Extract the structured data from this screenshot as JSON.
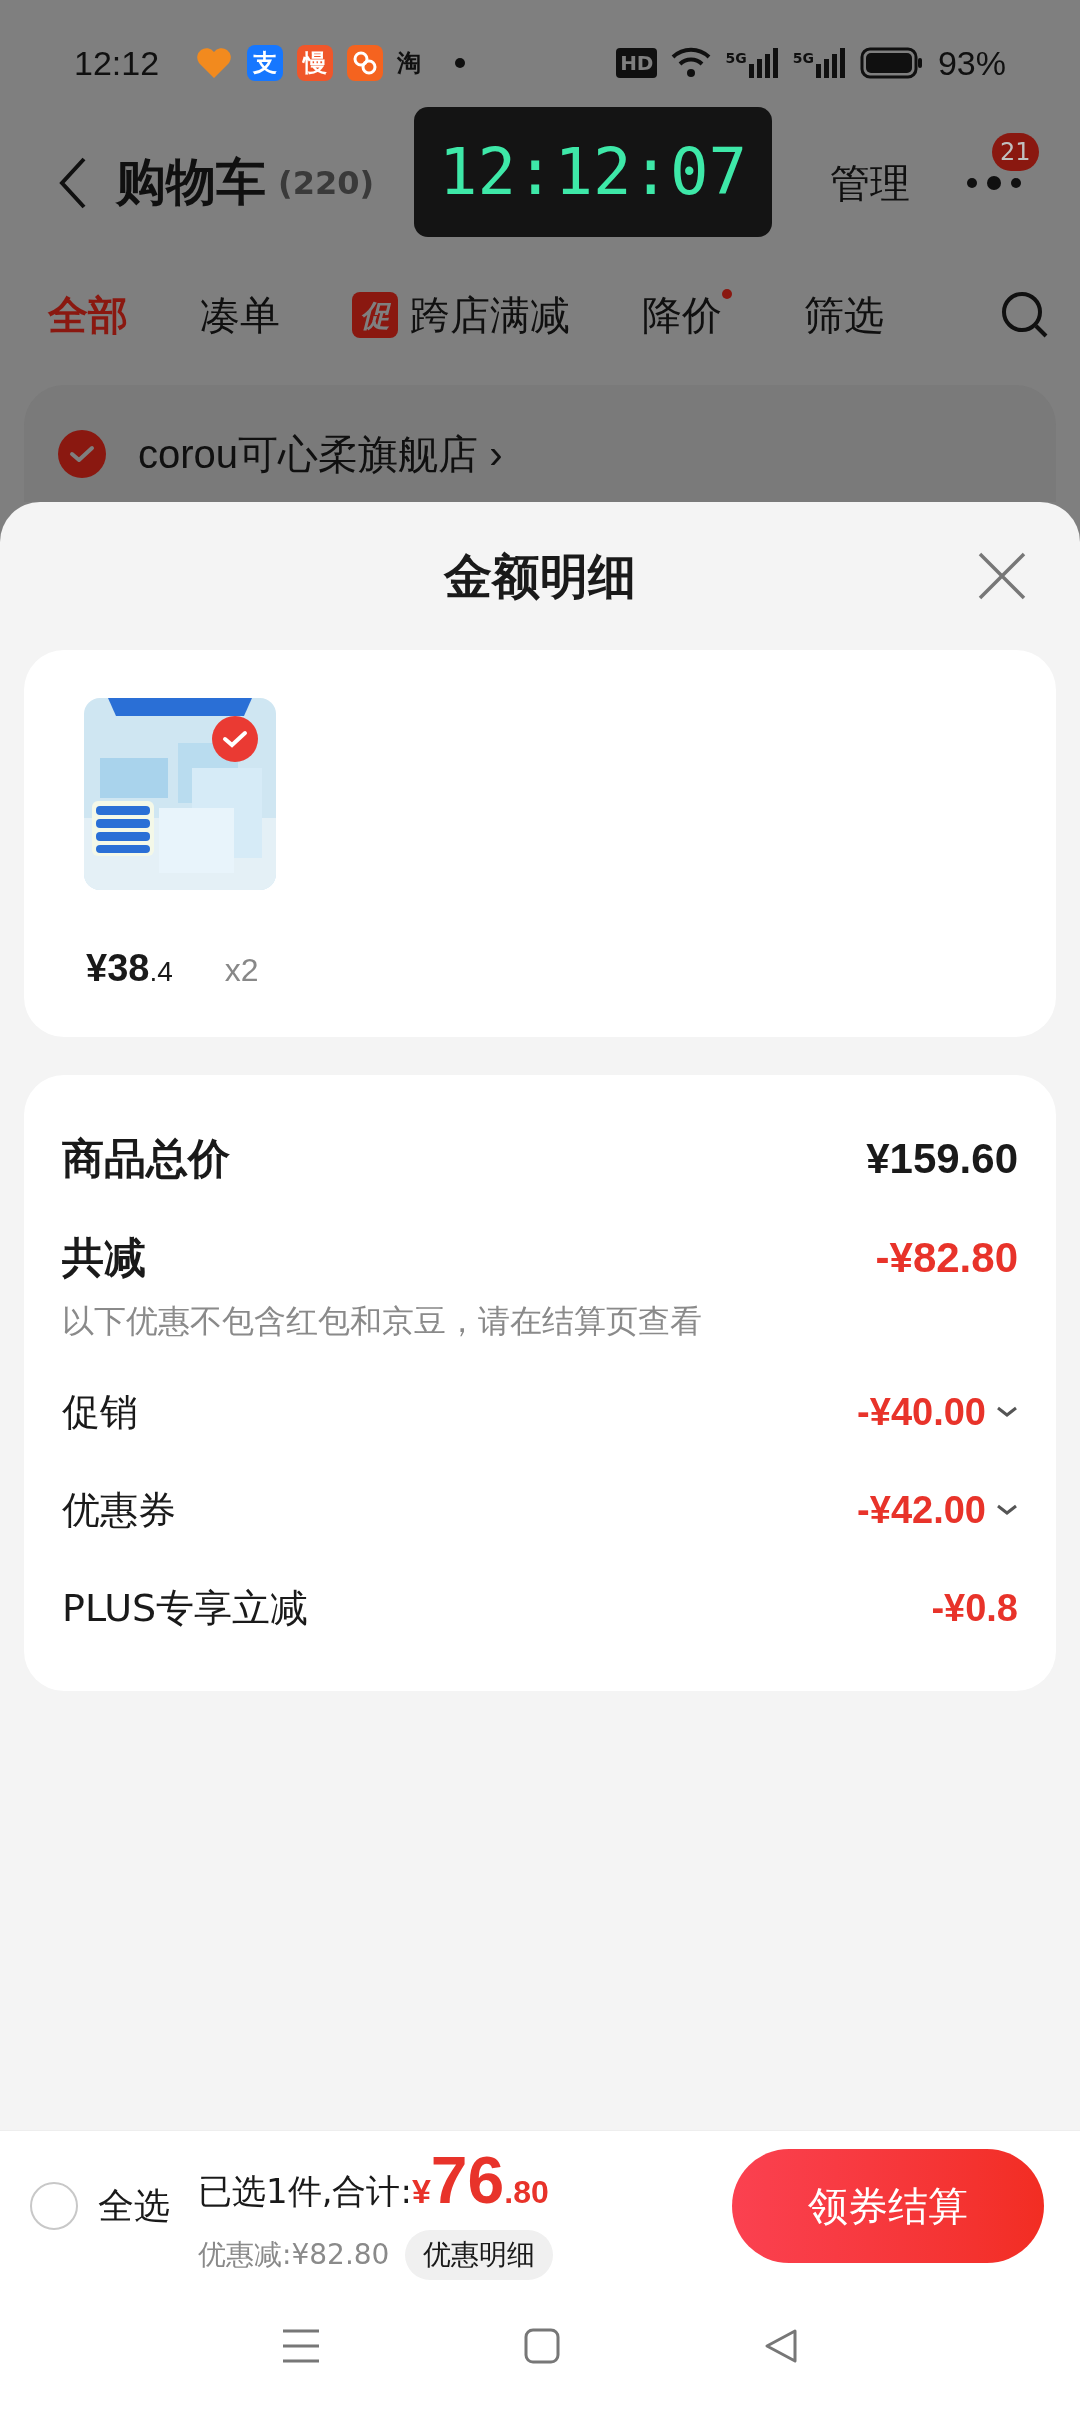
{
  "status_bar": {
    "time": "12:12",
    "notification_icons": [
      {
        "kind": "heart",
        "color": "#f28a1e"
      },
      {
        "kind": "tile",
        "label": "支",
        "color": "#1677ff"
      },
      {
        "kind": "tile",
        "label": "慢",
        "color": "#f0562a"
      },
      {
        "kind": "tile_icon",
        "color": "#f5631f"
      },
      {
        "kind": "glyph",
        "label": "淘"
      }
    ],
    "hd_label": "HD",
    "network_labels": [
      "5G",
      "5G"
    ],
    "battery": "93%"
  },
  "header": {
    "title": "购物车",
    "count": "(220)",
    "manage": "管理",
    "badge": "21"
  },
  "clock_overlay": {
    "time": "12:12:07"
  },
  "filter_tabs": [
    {
      "label": "全部",
      "selected": true
    },
    {
      "label": "凑单",
      "selected": false
    },
    {
      "label": "跨店满减",
      "selected": false,
      "tag": "促"
    },
    {
      "label": "降价",
      "selected": false,
      "dot": true
    },
    {
      "label": "筛选",
      "selected": false
    }
  ],
  "store": {
    "name": "corou可心柔旗舰店",
    "chevron": "›",
    "checked": true
  },
  "sheet": {
    "title": "金额明细",
    "items": [
      {
        "selected": true,
        "price_integer": "¥38",
        "price_decimal": ".4",
        "quantity": "x2"
      }
    ],
    "summary": [
      {
        "kind": "total",
        "label": "商品总价",
        "value": "¥159.60"
      },
      {
        "kind": "discount_total",
        "label": "共减",
        "value": "-¥82.80",
        "note": "以下优惠不包含红包和京豆，请在结算页查看"
      },
      {
        "kind": "line",
        "label": "促销",
        "value": "-¥40.00",
        "expandable": true
      },
      {
        "kind": "line",
        "label": "优惠券",
        "value": "-¥42.00",
        "expandable": true
      },
      {
        "kind": "line",
        "label": "PLUS专享立减",
        "value": "-¥0.8",
        "expandable": false
      }
    ]
  },
  "bottom_bar": {
    "select_all": {
      "label": "全选",
      "checked": false
    },
    "selected_text": "已选1件,合计:",
    "currency": "¥",
    "total_integer": "76",
    "total_decimal": ".80",
    "discount": "优惠减:¥82.80",
    "detail_button": "优惠明细",
    "checkout": "领券结算"
  }
}
